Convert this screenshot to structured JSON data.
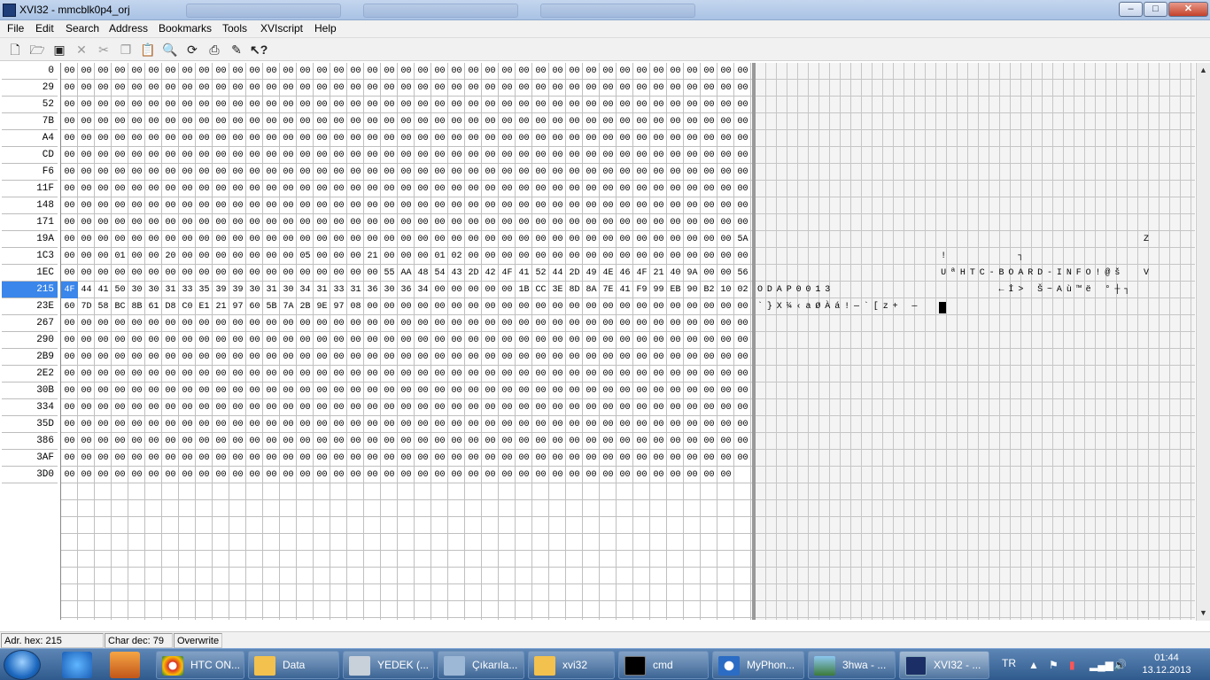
{
  "window": {
    "title": "XVI32 - mmcblk0p4_orj"
  },
  "menu": [
    "File",
    "Edit",
    "Search",
    "Address",
    "Bookmarks",
    "Tools",
    "XVIscript",
    "Help"
  ],
  "toolbar_icons": [
    "new-file-icon",
    "open-icon",
    "save-icon",
    "close-file-icon",
    "cut-icon",
    "copy-icon",
    "paste-icon",
    "find-icon",
    "replace-icon",
    "print-icon",
    "script-icon",
    "context-help-icon"
  ],
  "addresses": [
    "0",
    "29",
    "52",
    "7B",
    "A4",
    "CD",
    "F6",
    "11F",
    "148",
    "171",
    "19A",
    "1C3",
    "1EC",
    "215",
    "23E",
    "267",
    "290",
    "2B9",
    "2E2",
    "30B",
    "334",
    "35D",
    "386",
    "3AF",
    "3D0"
  ],
  "selected_address": "215",
  "hex_rows": {
    "r10": "00 00 00 00 00 00 00 00 00 00 00 00 00 00 00 00 00 00 00 00 00 00 00 00 00 00 00 00 00 00 00 00 00 00 00 00 00 00 00 00 5A",
    "r11": "00 00 00 01 00 00 20 00 00 00 00 00 00 00 05 00 00 00 21 00 00 00 01 02 00 00 00 00 00 00 00 00 00 00 00 00 00 00 00 00 00",
    "r12": "00 00 00 00 00 00 00 00 00 00 00 00 00 00 00 00 00 00 00 55 AA 48 54 43 2D 42 4F 41 52 44 2D 49 4E 46 4F 21 40 9A 00 00 56",
    "r13": "4F 44 41 50 30 30 31 33 35 39 39 30 31 30 34 31 33 31 36 30 36 34 00 00 00 00 00 1B CC 3E 8D 8A 7E 41 F9 99 EB 90 B2 10 02",
    "r14": "60 7D 58 BC 8B 61 D8 C0 E1 21 97 60 5B 7A 2B 9E 97 08 00 00 00 00 00 00 00 00 00 00 00 00 00 00 00 00 00 00 00 00 00 00 00",
    "last": "00 00 00 00 00 00 00 00 00 00 00 00 00 00 00 00 00 00 00 00 00 00 00 00 00 00 00 00 00 00 00 00 00 00 00 00 00 00 00 00"
  },
  "char_rows": {
    "r10": "                                        Z",
    "r11": "                   !       ┐            ",
    "r12": "                   UªHTC-BOARD-INFO!@š  V",
    "r13": "ODAP0013                 ←İ> Š~Aù™ë °┼┐",
    "r14": "`}X¼‹aØÀá!—`[z+ —                       "
  },
  "status": {
    "addr": "Adr. hex: 215",
    "char": "Char dec: 79",
    "mode": "Overwrite"
  },
  "taskbar": {
    "tasks": [
      "HTC ON...",
      "Data",
      "YEDEK (...",
      "Çıkarıla...",
      "xvi32",
      "cmd",
      "MyPhon...",
      "3hwa - ...",
      "XVI32 - ..."
    ],
    "lang": "TR",
    "time": "01:44",
    "date": "13.12.2013"
  },
  "colors": {
    "selection": "#3a86ea",
    "taskbar": "#2f5a8d"
  }
}
